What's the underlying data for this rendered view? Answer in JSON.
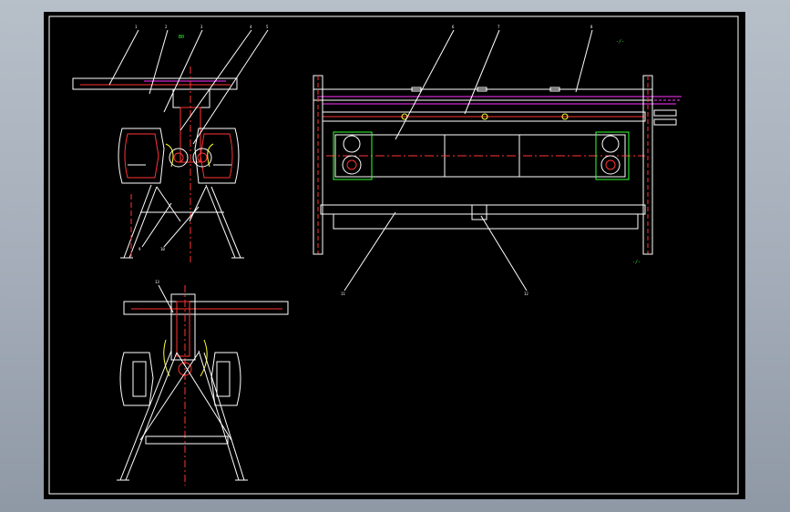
{
  "drawing": {
    "title": "",
    "annotation_top_left": "B0",
    "annotation_right_top": "-/-",
    "annotation_right_bottom": "-/-",
    "colors": {
      "background": "#000000",
      "frame": "#ffffff",
      "outline": "#ffffff",
      "hidden": "#ff3333",
      "center": "#ff3333",
      "highlight": "#ff33ff",
      "accent": "#33ff33",
      "detail": "#ffff33",
      "window_bg": "#a3acb8"
    },
    "views": [
      "front-view",
      "side-view",
      "rear-view"
    ],
    "balloons": [
      "1",
      "2",
      "3",
      "4",
      "5",
      "6",
      "7",
      "8",
      "9",
      "10",
      "11",
      "12",
      "13"
    ]
  }
}
